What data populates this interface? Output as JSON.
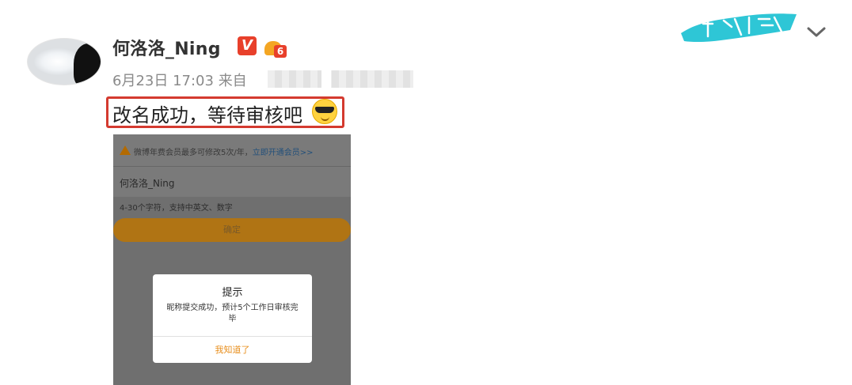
{
  "post": {
    "username": "何洛洛_Ning",
    "vip_badge": "V",
    "level": "6",
    "date": "6月23日 17:03",
    "source_prefix": "来自",
    "text": "改名成功，等待审核吧"
  },
  "screenshot": {
    "notice": "微博年费会员最多可修改5次/年，",
    "notice_link": "立即开通会员>>",
    "name_value": "何洛洛_Ning",
    "hint": "4-30个字符，支持中英文、数字",
    "confirm_label": "确定",
    "dialog": {
      "title": "提示",
      "message": "昵称提交成功，预计5个工作日审核完毕",
      "button": "我知道了"
    }
  },
  "icons": {
    "avatar": "avatar",
    "vip": "vip-badge-icon",
    "crown": "crown-level-icon",
    "emoji": "sunglasses-emoji-icon",
    "logo": "brush-logo-icon",
    "menu": "chevron-down-icon",
    "warning": "warning-icon"
  },
  "colors": {
    "highlight_border": "#d43a2f",
    "vip_red": "#e8402b",
    "crown_gold": "#f4a623",
    "logo_cyan": "#2ec6d6",
    "dialog_button": "#e88f1e"
  }
}
